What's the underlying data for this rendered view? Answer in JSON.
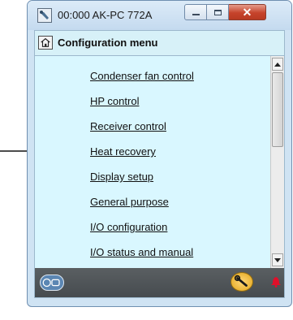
{
  "window": {
    "title": "00:000 AK-PC 772A",
    "controls": {
      "minimize": "minimize",
      "maximize": "maximize",
      "close": "close"
    }
  },
  "header": {
    "title": "Configuration menu",
    "home_icon": "home-icon"
  },
  "menu": {
    "items": [
      {
        "label": "Condenser fan control"
      },
      {
        "label": "HP control"
      },
      {
        "label": "Receiver control"
      },
      {
        "label": "Heat recovery"
      },
      {
        "label": "Display setup"
      },
      {
        "label": "General purpose"
      },
      {
        "label": "I/O configuration"
      },
      {
        "label": "I/O status and manual"
      }
    ]
  },
  "statusbar": {
    "left_icon": "controller-icon",
    "tool_icon": "wrench-icon",
    "alarm_icon": "alarm-bell-icon"
  },
  "colors": {
    "list_background": "#d9f7ff",
    "status_background": "#4e5356",
    "alarm": "#e0102a"
  }
}
